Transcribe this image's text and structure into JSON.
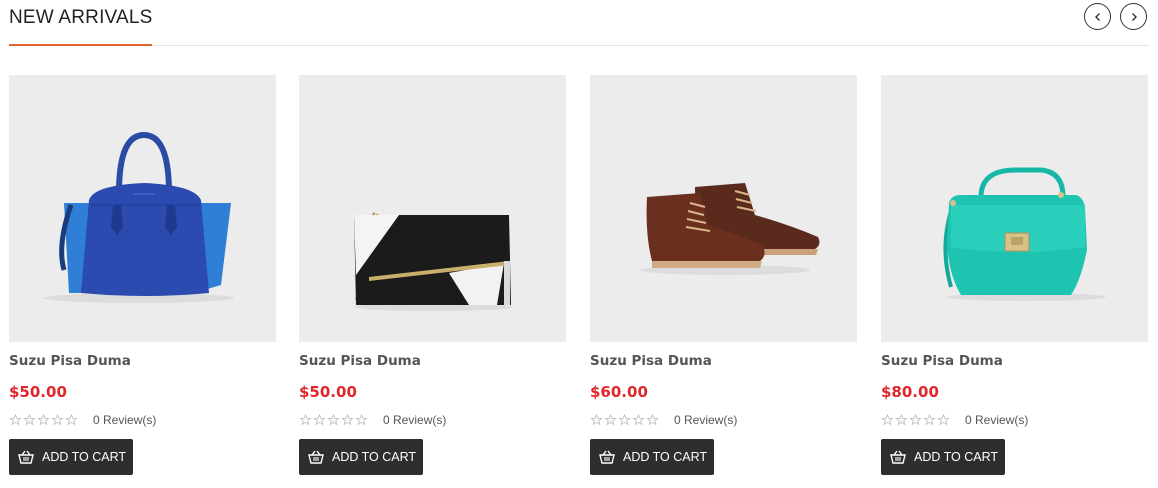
{
  "section": {
    "title": "NEW ARRIVALS",
    "accent_color": "#e8632b",
    "nav": {
      "prev_icon": "chevron-left-icon",
      "next_icon": "chevron-right-icon"
    }
  },
  "products": [
    {
      "name": "Suzu Pisa Duma",
      "price": "$50.00",
      "rating": 0,
      "reviews": "0 Review(s)",
      "button": "ADD TO CART",
      "image": "blue-handbag"
    },
    {
      "name": "Suzu Pisa Duma",
      "price": "$50.00",
      "rating": 0,
      "reviews": "0 Review(s)",
      "button": "ADD TO CART",
      "image": "black-white-clutch"
    },
    {
      "name": "Suzu Pisa Duma",
      "price": "$60.00",
      "rating": 0,
      "reviews": "0 Review(s)",
      "button": "ADD TO CART",
      "image": "brown-boots"
    },
    {
      "name": "Suzu Pisa Duma",
      "price": "$80.00",
      "rating": 0,
      "reviews": "0 Review(s)",
      "button": "ADD TO CART",
      "image": "teal-handbag"
    }
  ],
  "colors": {
    "price": "#e0262b",
    "button_bg": "#2e2e2e",
    "image_bg": "#ececec"
  }
}
